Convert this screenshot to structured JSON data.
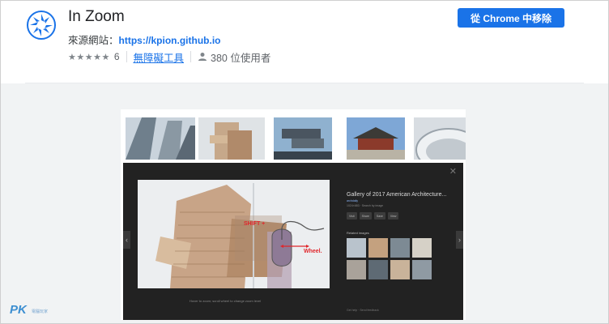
{
  "extension": {
    "title": "In Zoom",
    "source_label": "來源網站：",
    "source_url": "https://kpion.github.io",
    "stars": "★★★★★",
    "rating_count": "6",
    "category": "無障礙工具",
    "users": "380 位使用者",
    "remove_button": "從 Chrome 中移除"
  },
  "screenshot": {
    "viewer": {
      "title": "Gallery of 2017 American Architecture...",
      "source": "archdaily",
      "size": "1024×683 · Search by image",
      "buttons": [
        "Visit",
        "Share",
        "Save",
        "View"
      ],
      "related_label": "Related images",
      "footer": "Get help · Send feedback",
      "caption": "Hover to zoom; scroll wheel to change zoom level",
      "close": "✕",
      "nav_left": "‹",
      "nav_right": "›"
    },
    "annotation": {
      "shift": "SHIFT +",
      "wheel": "Wheel."
    }
  },
  "watermark": {
    "brand": "PK",
    "sub": "電腦玩家"
  },
  "colors": {
    "accent": "#1a73e8",
    "annotation_red": "#e0262b",
    "logo_blue": "#1a73e8"
  }
}
